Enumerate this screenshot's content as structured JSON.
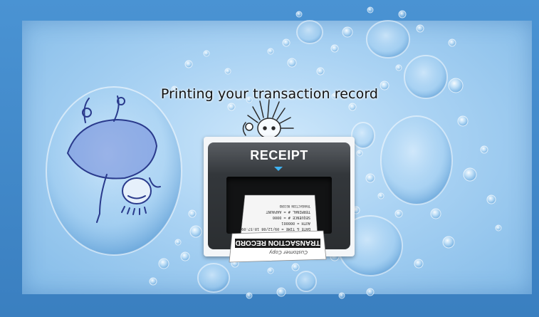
{
  "message": "Printing your transaction record",
  "card": {
    "title": "RECEIPT",
    "receipt_lines": [
      "DATE & TIME   =   09/12/08  18:57:09",
      "AUTH          =   000001",
      "SEQUENCE #    =   0000",
      "TERMINAL #    =   AAPAUNT"
    ],
    "receipt_header": "TRANSACTION RECORD",
    "stub_copy": "Customer Copy",
    "stub_label": "TRANSACTION RECORD"
  },
  "colors": {
    "frame": "#3f84c2",
    "panel": "#a9d2f3",
    "arrow": "#3fb3f2"
  }
}
